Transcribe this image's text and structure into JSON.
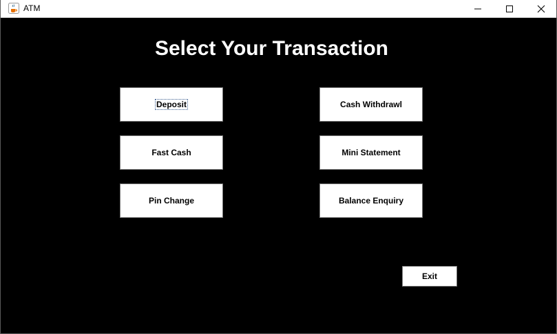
{
  "window": {
    "title": "ATM",
    "icon": "java-cup-icon",
    "controls": {
      "minimize": "minimize-icon",
      "maximize": "maximize-icon",
      "close": "close-icon"
    }
  },
  "main": {
    "heading": "Select Your Transaction",
    "buttons": {
      "deposit": "Deposit",
      "cash_withdrawl": "Cash Withdrawl",
      "fast_cash": "Fast Cash",
      "mini_statement": "Mini Statement",
      "pin_change": "Pin Change",
      "balance_enquiry": "Balance Enquiry",
      "exit": "Exit"
    }
  },
  "colors": {
    "background": "#000000",
    "heading": "#ffffff",
    "button_bg": "#ffffff",
    "button_text": "#000000"
  }
}
